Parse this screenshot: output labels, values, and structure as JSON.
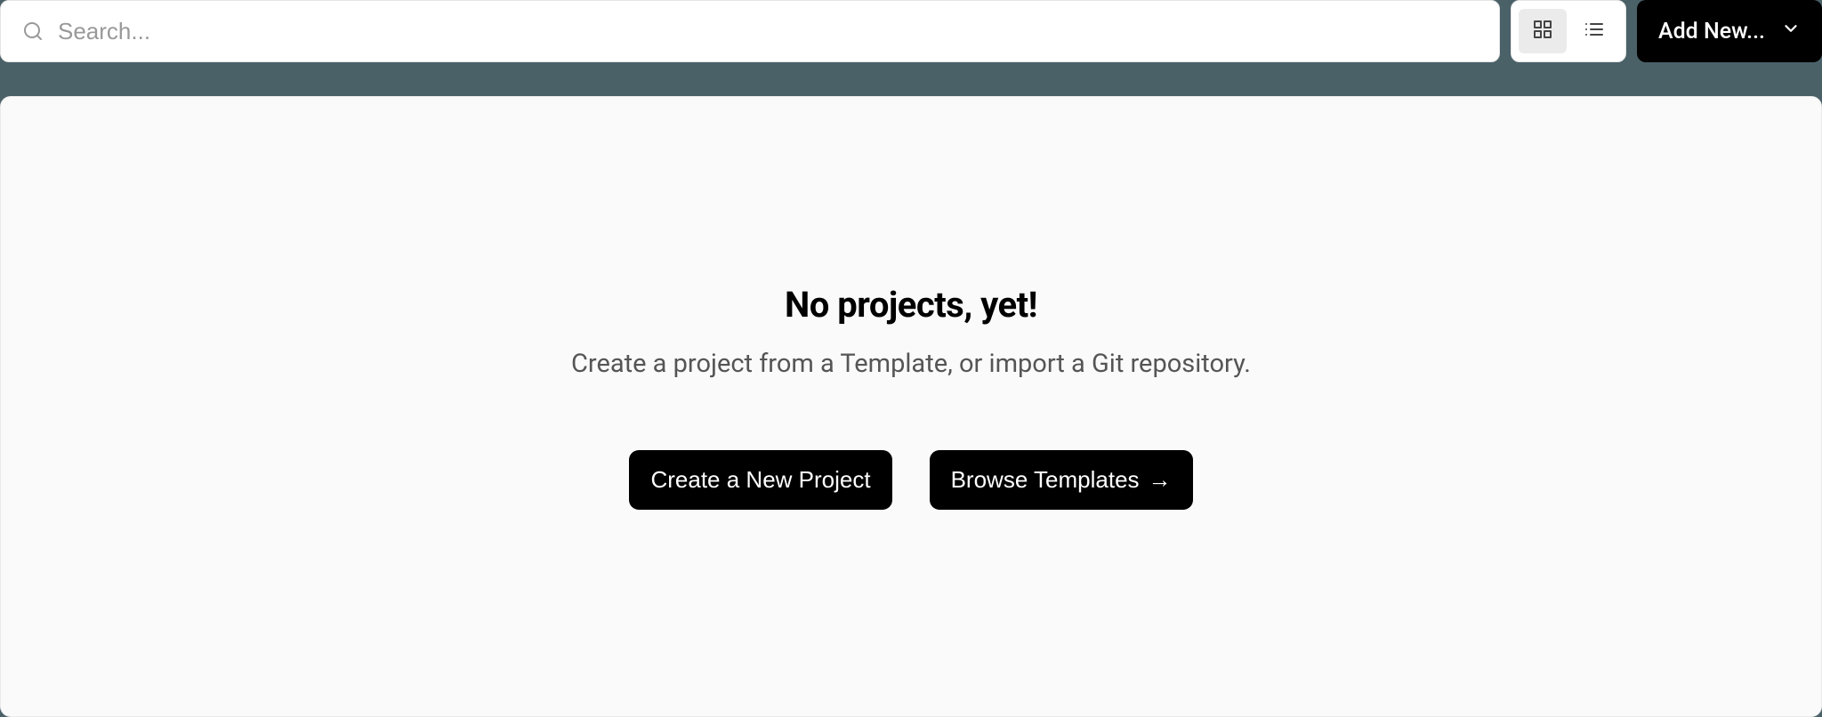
{
  "topbar": {
    "search_placeholder": "Search...",
    "add_new_label": "Add New..."
  },
  "empty_state": {
    "title": "No projects, yet!",
    "subtitle": "Create a project from a Template, or import a Git repository.",
    "create_button": "Create a New Project",
    "browse_button": "Browse Templates",
    "browse_arrow": "→"
  }
}
